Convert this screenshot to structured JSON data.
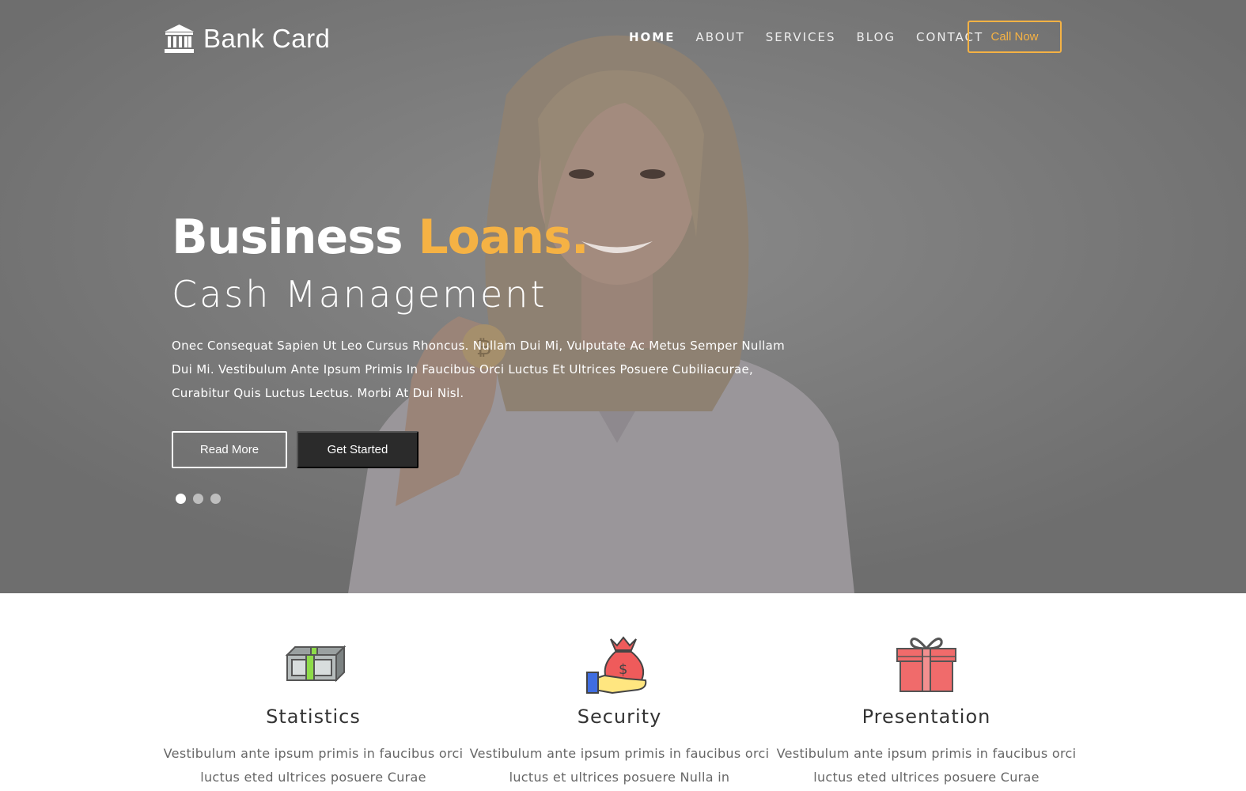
{
  "brand": {
    "name": "Bank Card",
    "logo_icon": "bank-icon"
  },
  "nav": {
    "items": [
      {
        "label": "HOME",
        "active": true
      },
      {
        "label": "ABOUT",
        "active": false
      },
      {
        "label": "SERVICES",
        "active": false
      },
      {
        "label": "BLOG",
        "active": false
      },
      {
        "label": "CONTACT",
        "active": false
      }
    ],
    "cta_label": "Call Now"
  },
  "hero": {
    "title_main": "Business ",
    "title_accent": "Loans.",
    "subtitle": "Cash Management",
    "description": "Onec Consequat Sapien Ut Leo Cursus Rhoncus. Nullam Dui Mi, Vulputate Ac Metus Semper Nullam Dui Mi. Vestibulum Ante Ipsum Primis In Faucibus Orci Luctus Et Ultrices Posuere Cubiliacurae, Curabitur Quis Luctus Lectus. Morbi At Dui Nisl.",
    "read_more_label": "Read More",
    "get_started_label": "Get Started",
    "slides": 3,
    "active_slide": 1
  },
  "features": [
    {
      "title": "Statistics",
      "icon": "cash-stack-icon",
      "text": "Vestibulum ante ipsum primis in faucibus orci luctus eted ultrices posuere Curae"
    },
    {
      "title": "Security",
      "icon": "money-bag-hand-icon",
      "text": "Vestibulum ante ipsum primis in faucibus orci luctus et ultrices posuere Nulla in"
    },
    {
      "title": "Presentation",
      "icon": "gift-box-icon",
      "text": "Vestibulum ante ipsum primis in faucibus orci luctus eted ultrices posuere Curae"
    }
  ],
  "colors": {
    "accent": "#f5b244",
    "dark_button": "#2b2b2b",
    "hero_overlay": "#777777"
  }
}
